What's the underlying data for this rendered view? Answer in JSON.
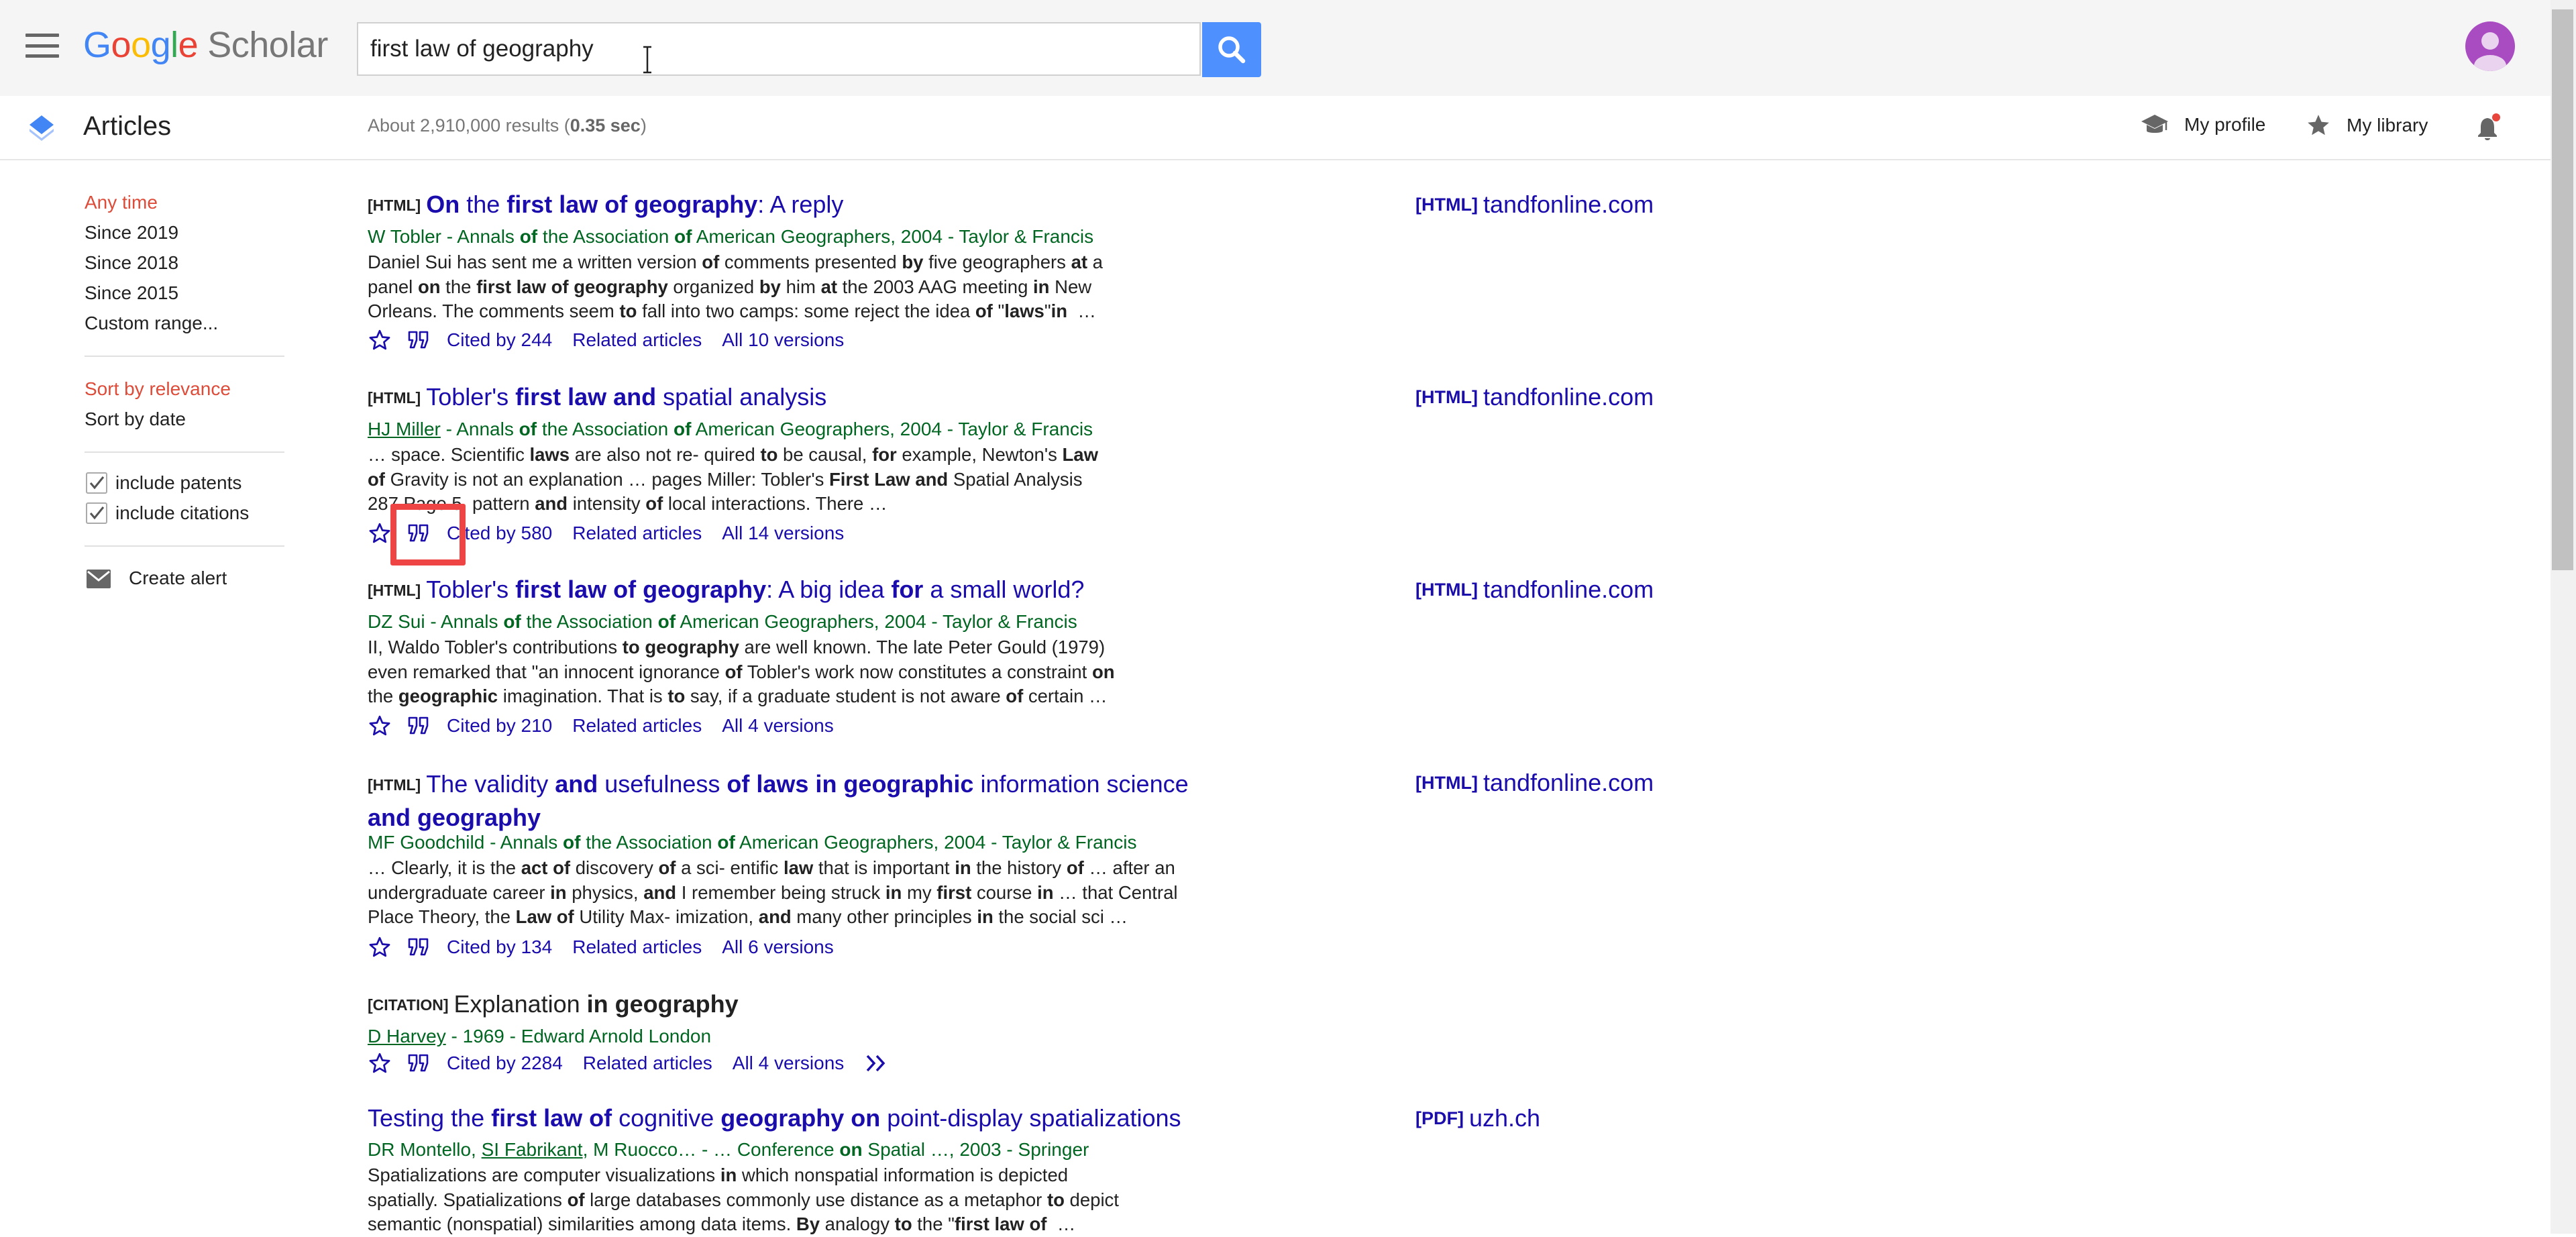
{
  "header": {
    "logo": {
      "letters": [
        "G",
        "o",
        "o",
        "g",
        "l",
        "e"
      ],
      "product": "Scholar"
    },
    "search": {
      "value": "first law of geography",
      "placeholder": ""
    },
    "menu_icon": "hamburger-menu-icon",
    "search_icon": "magnifier-icon",
    "avatar_color": "#a94bc1"
  },
  "subbar": {
    "section_title": "Articles",
    "results_stats_prefix": "About 2,910,000 results (",
    "results_stats_time": "0.35 sec",
    "results_stats_suffix": ")",
    "my_profile": "My profile",
    "my_library": "My library",
    "notification_dot_color": "#e8453c"
  },
  "sidebar": {
    "time_filters": [
      "Any time",
      "Since 2019",
      "Since 2018",
      "Since 2015",
      "Custom range..."
    ],
    "sort_options": [
      "Sort by relevance",
      "Sort by date"
    ],
    "checkboxes": [
      {
        "label": "include patents",
        "checked": true
      },
      {
        "label": "include citations",
        "checked": true
      }
    ],
    "create_alert": "Create alert",
    "selected_color": "#dd4b39"
  },
  "results": [
    {
      "tag": "[HTML]",
      "title_html": "<b>On</b> the <b>first law of geography</b>: A reply",
      "authors_html": "W Tobler - Annals <b>of</b> the Association <b>of</b> American Geographers, 2004 - Taylor &amp; Francis",
      "snippet_html": "Daniel Sui has sent me a written version <b>of</b> comments presented <b>by</b> five geographers <b>at</b> a<br>panel <b>on</b> the <b>first law of geography</b> organized <b>by</b> him <b>at</b> the 2003 AAG meeting <b>in</b> New<br>Orleans. The comments seem <b>to</b> fall into two camps: some reject the idea <b>of</b> \"<b>laws</b>\"<b>in</b> &nbsp;…",
      "cited_by": "Cited by 244",
      "related": "Related articles",
      "versions": "All 10 versions",
      "side_tag": "[HTML]",
      "side_domain": "tandfonline.com"
    },
    {
      "tag": "[HTML]",
      "title_html": "Tobler's <b>first law and</b> spatial analysis",
      "authors_html": "<u>HJ Miller</u> - Annals <b>of</b> the Association <b>of</b> American Geographers, 2004 - Taylor &amp; Francis",
      "snippet_html": "… space. Scientific <b>laws</b> are also not re- quired <b>to</b> be causal, <b>for</b> example, Newton's <b>Law</b><br><b>of</b> Gravity is not an explanation … pages Miller: Tobler's <b>First Law and</b> Spatial Analysis<br>287 Page 5. pattern <b>and</b> intensity <b>of</b> local interactions. There …",
      "cited_by": "Cited by 580",
      "related": "Related articles",
      "versions": "All 14 versions",
      "side_tag": "[HTML]",
      "side_domain": "tandfonline.com"
    },
    {
      "tag": "[HTML]",
      "title_html": "Tobler's <b>first law of geography</b>: A big idea <b>for</b> a small world?",
      "authors_html": "DZ Sui - Annals <b>of</b> the Association <b>of</b> American Geographers, 2004 - Taylor &amp; Francis",
      "snippet_html": "II, Waldo Tobler's contributions <b>to geography</b> are well known. The late Peter Gould (1979)<br>even remarked that \"an innocent ignorance <b>of</b> Tobler's work now constitutes a constraint <b>on</b><br>the <b>geographic</b> imagination. That is <b>to</b> say, if a graduate student is not aware <b>of</b> certain …",
      "cited_by": "Cited by 210",
      "related": "Related articles",
      "versions": "All 4 versions",
      "side_tag": "[HTML]",
      "side_domain": "tandfonline.com"
    },
    {
      "tag": "[HTML]",
      "title_html": "The validity <b>and</b> usefulness <b>of laws in geographic</b> information science<br><b>and geography</b>",
      "authors_html": "MF Goodchild - Annals <b>of</b> the Association <b>of</b> American Geographers, 2004 - Taylor &amp; Francis",
      "snippet_html": "… Clearly, it is the <b>act of</b> discovery <b>of</b> a sci- entific <b>law</b> that is important <b>in</b> the history <b>of</b> … after an<br>undergraduate career <b>in</b> physics, <b>and</b> I remember being struck <b>in</b> my <b>first</b> course <b>in</b> … that Central<br>Place Theory, the <b>Law of</b> Utility Max- imization, <b>and</b> many other principles <b>in</b> the social sci …",
      "cited_by": "Cited by 134",
      "related": "Related articles",
      "versions": "All 6 versions",
      "side_tag": "[HTML]",
      "side_domain": "tandfonline.com"
    },
    {
      "tag": "[CITATION]",
      "title_html": "Explanation <b>in geography</b>",
      "authors_html": "<u>D Harvey</u> - 1969 - Edward Arnold London",
      "snippet_html": "",
      "cited_by": "Cited by 2284",
      "related": "Related articles",
      "versions": "All 4 versions",
      "side_tag": "",
      "side_domain": ""
    },
    {
      "tag": "",
      "title_html": "Testing the <b>first law of</b> cognitive <b>geography on</b> point-display spatializations",
      "authors_html": "DR Montello, <u>SI Fabrikant</u>, M Ruocco… - … Conference <b>on</b> Spatial …, 2003 - Springer",
      "snippet_html": "Spatializations are computer visualizations <b>in</b> which nonspatial information is depicted<br>spatially. Spatializations <b>of</b> large databases commonly use distance as a metaphor <b>to</b> depict<br>semantic (nonspatial) similarities among data items. <b>By</b> analogy <b>to</b> the \"<b>first law of</b> &nbsp;…",
      "cited_by": "",
      "related": "",
      "versions": "",
      "side_tag": "[PDF]",
      "side_domain": "uzh.ch"
    }
  ],
  "icons": {
    "star": "star-outline-icon",
    "cite": "quote-icon",
    "more": "double-chevron-right-icon",
    "alert": "envelope-icon",
    "profile": "graduation-cap-icon",
    "library": "star-filled-icon",
    "bell": "bell-icon"
  },
  "highlight_color": "#ef4444"
}
